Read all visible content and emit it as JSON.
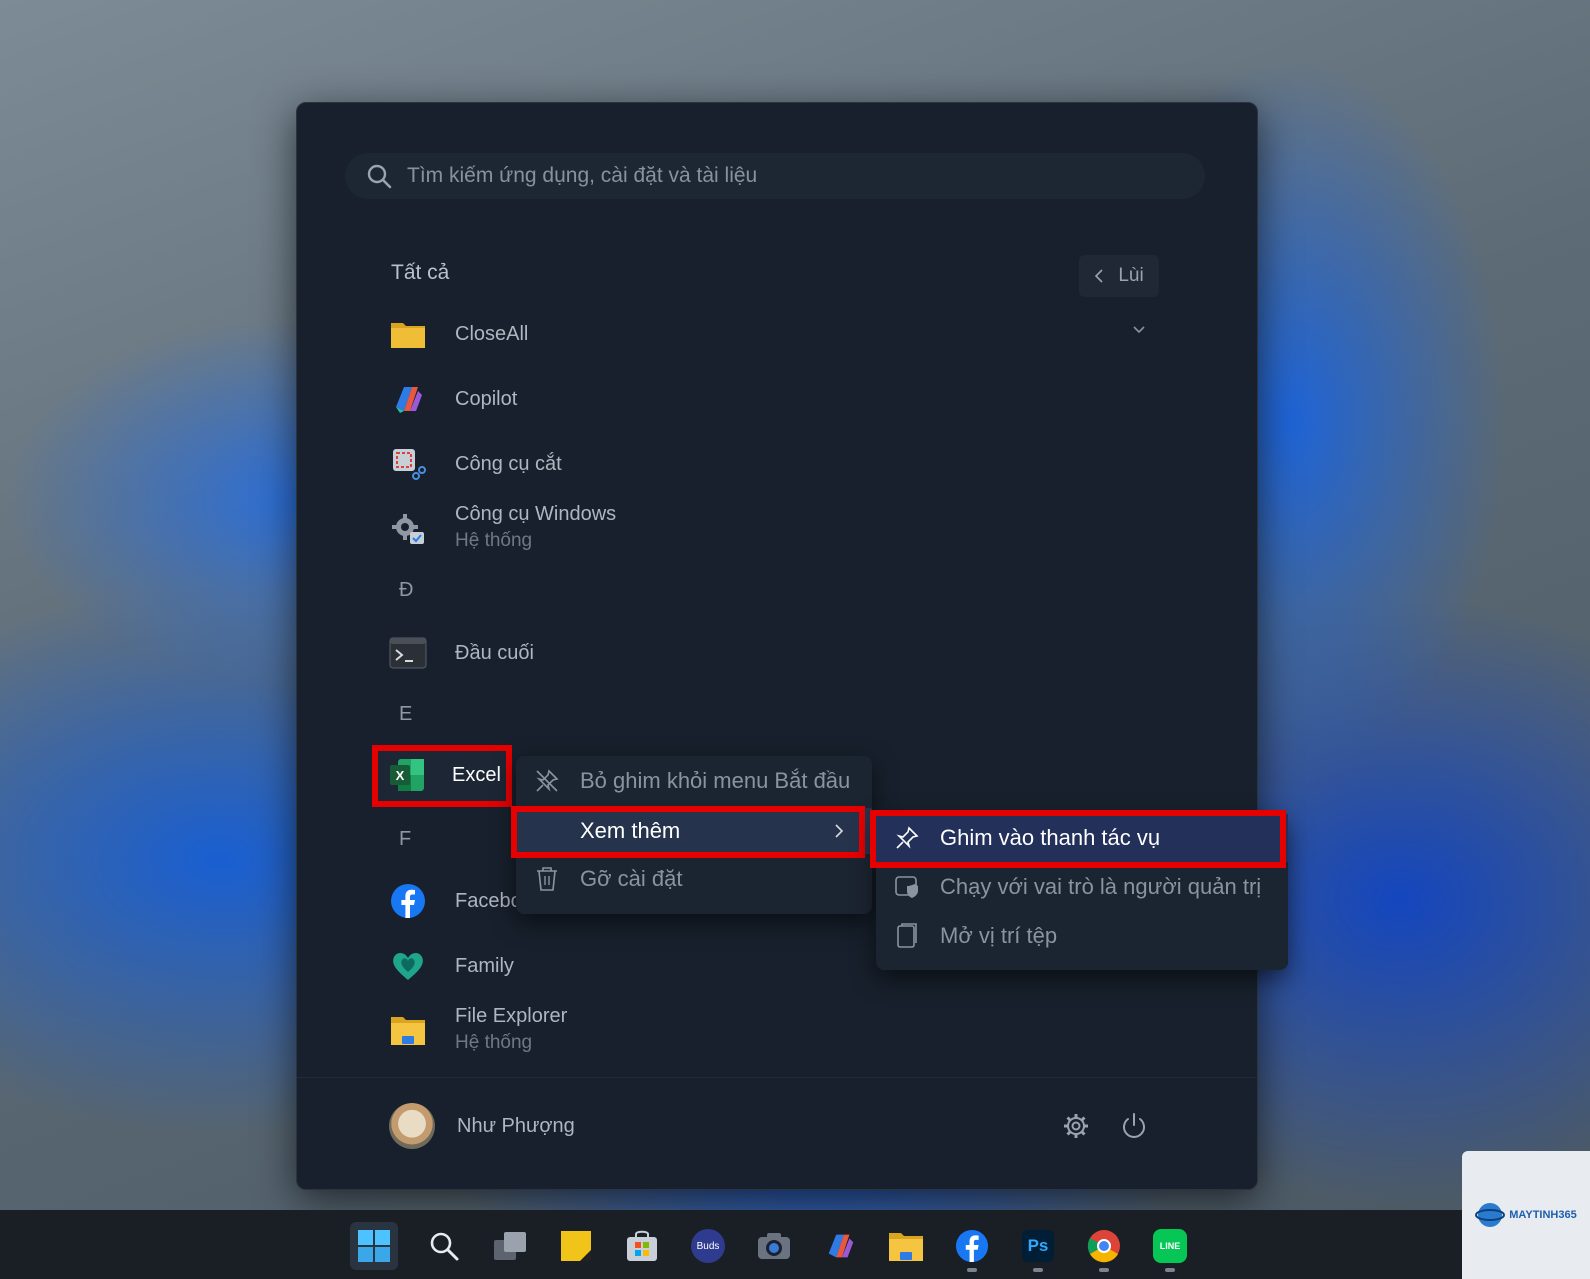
{
  "search": {
    "placeholder": "Tìm kiếm ứng dụng, cài đặt và tài liệu"
  },
  "all_apps": {
    "title": "Tất cả",
    "back_label": "Lùi"
  },
  "apps": [
    {
      "name": "CloseAll",
      "icon": "folder-icon"
    },
    {
      "name": "Copilot",
      "icon": "copilot-icon"
    },
    {
      "name": "Công cụ cắt",
      "icon": "snipping-tool-icon"
    },
    {
      "name": "Công cụ Windows",
      "sub": "Hệ thống",
      "icon": "windows-tools-icon"
    },
    {
      "name": "Đầu cuối",
      "icon": "terminal-icon"
    },
    {
      "name": "Excel",
      "icon": "excel-icon"
    },
    {
      "name": "Facebook",
      "icon": "facebook-icon"
    },
    {
      "name": "Family",
      "icon": "family-icon"
    },
    {
      "name": "File Explorer",
      "sub": "Hệ thống",
      "icon": "file-explorer-icon"
    }
  ],
  "letters": {
    "d": "Đ",
    "e": "E",
    "f": "F"
  },
  "context_menu": {
    "unpin": "Bỏ ghim khỏi menu Bắt đầu",
    "see_more": "Xem thêm",
    "uninstall": "Gỡ cài đặt"
  },
  "submenu": {
    "pin_taskbar": "Ghim vào thanh tác vụ",
    "run_admin": "Chạy với vai trò là người quản trị",
    "open_location": "Mở vị trí tệp"
  },
  "user": {
    "name": "Như Phượng"
  },
  "taskbar": {
    "buds_label": "Buds",
    "ps_label": "Ps",
    "line_label": "LINE",
    "excel_letter": "X"
  },
  "watermark": {
    "text": "MAYTINH365"
  },
  "colors": {
    "highlight_red": "#e60000",
    "menu_bg": "#17202c",
    "selected_item": "#22305a"
  }
}
